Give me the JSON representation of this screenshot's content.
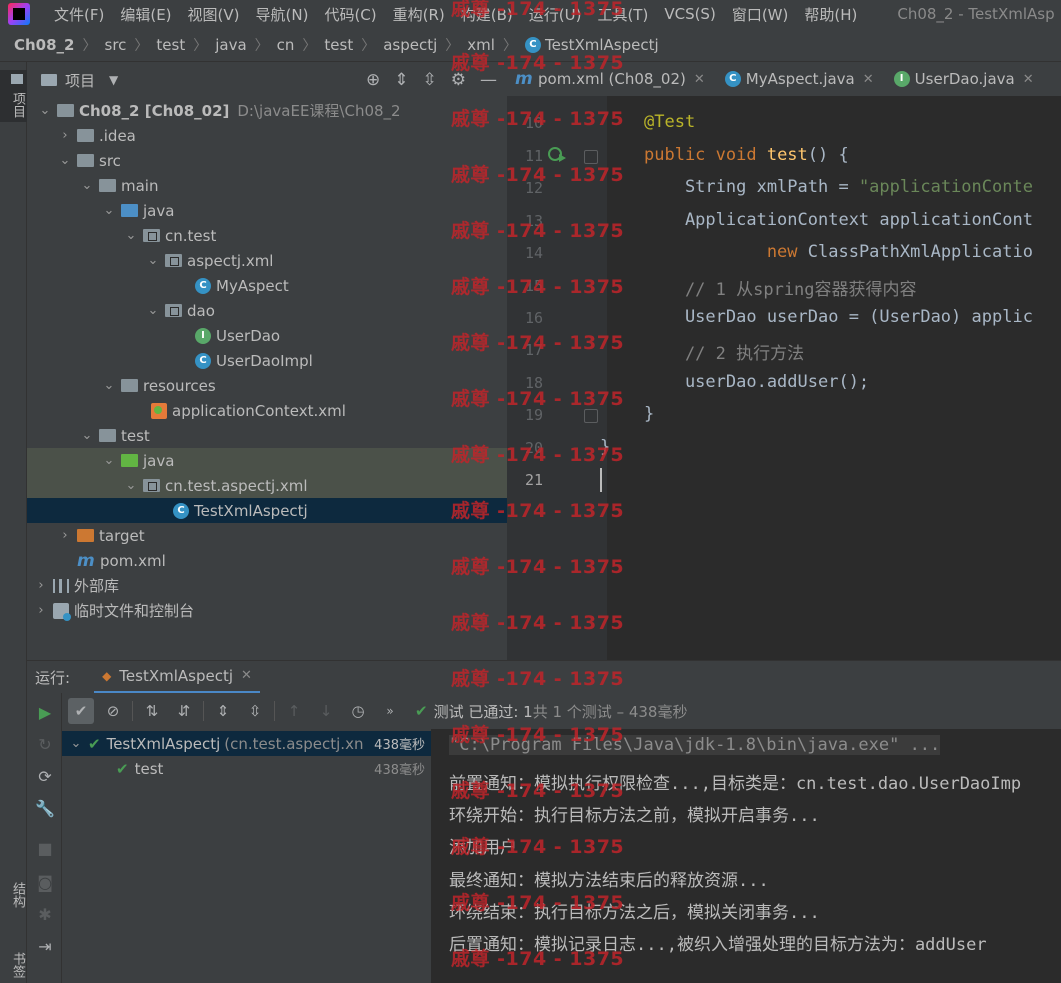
{
  "menu": {
    "items": [
      "文件(F)",
      "编辑(E)",
      "视图(V)",
      "导航(N)",
      "代码(C)",
      "重构(R)",
      "构建(B)",
      "运行(U)",
      "工具(T)",
      "VCS(S)",
      "窗口(W)",
      "帮助(H)"
    ],
    "window_title": "Ch08_2 - TestXmlAsp"
  },
  "breadcrumb": [
    "Ch08_2",
    "src",
    "test",
    "java",
    "cn",
    "test",
    "aspectj",
    "xml",
    "TestXmlAspectj"
  ],
  "side_tabs": {
    "project": "项目",
    "structure": "结构",
    "bookmarks": "书签"
  },
  "project_panel": {
    "title": "项目",
    "tree": [
      {
        "label": "Ch08_2 [Ch08_02]",
        "path": "D:\\javaEE课程\\Ch08_2"
      },
      {
        "label": ".idea"
      },
      {
        "label": "src"
      },
      {
        "label": "main"
      },
      {
        "label": "java"
      },
      {
        "label": "cn.test"
      },
      {
        "label": "aspectj.xml"
      },
      {
        "label": "MyAspect"
      },
      {
        "label": "dao"
      },
      {
        "label": "UserDao"
      },
      {
        "label": "UserDaoImpl"
      },
      {
        "label": "resources"
      },
      {
        "label": "applicationContext.xml"
      },
      {
        "label": "test"
      },
      {
        "label": "java"
      },
      {
        "label": "cn.test.aspectj.xml"
      },
      {
        "label": "TestXmlAspectj"
      },
      {
        "label": "target"
      },
      {
        "label": "pom.xml"
      },
      {
        "label": "外部库"
      },
      {
        "label": "临时文件和控制台"
      }
    ]
  },
  "editor": {
    "tabs": [
      {
        "label": "pom.xml (Ch08_02)"
      },
      {
        "label": "MyAspect.java"
      },
      {
        "label": "UserDao.java"
      }
    ],
    "line_numbers": [
      "10",
      "11",
      "12",
      "13",
      "14",
      "15",
      "16",
      "17",
      "18",
      "19",
      "20",
      "21"
    ],
    "code": {
      "l10": "@Test",
      "l11_kw": "public void ",
      "l11_fn": "test",
      "l11_rest": "() {",
      "l12_pre": "    String xmlPath = ",
      "l12_str": "\"applicationConte",
      "l13": "    ApplicationContext applicationCont",
      "l14_kw": "            new ",
      "l14_rest": "ClassPathXmlApplicatio",
      "l15": "    // 1 从spring容器获得内容",
      "l16": "    UserDao userDao = (UserDao) applic",
      "l17": "    // 2 执行方法",
      "l18": "    userDao.addUser();",
      "l19": "}",
      "l20": "}"
    }
  },
  "run": {
    "label": "运行:",
    "tab": "TestXmlAspectj",
    "status_passed": "测试 已通过: 1",
    "status_count": "共 1 个测试 – 438毫秒",
    "tests": [
      {
        "name": "TestXmlAspectj",
        "sub": "(cn.test.aspectj.xn",
        "duration": "438毫秒"
      },
      {
        "name": "test",
        "duration": "438毫秒"
      }
    ],
    "console": [
      "\"C:\\Program Files\\Java\\jdk-1.8\\bin\\java.exe\" ...",
      "前置通知：模拟执行权限检查...,目标类是：cn.test.dao.UserDaoImp",
      "环绕开始：执行目标方法之前，模拟开启事务...",
      "添加用户",
      "最终通知：模拟方法结束后的释放资源...",
      "环绕结束：执行目标方法之后，模拟关闭事务...",
      "后置通知：模拟记录日志...,被织入增强处理的目标方法为：addUser"
    ]
  },
  "watermark": "戚尊 -174 - 1375"
}
